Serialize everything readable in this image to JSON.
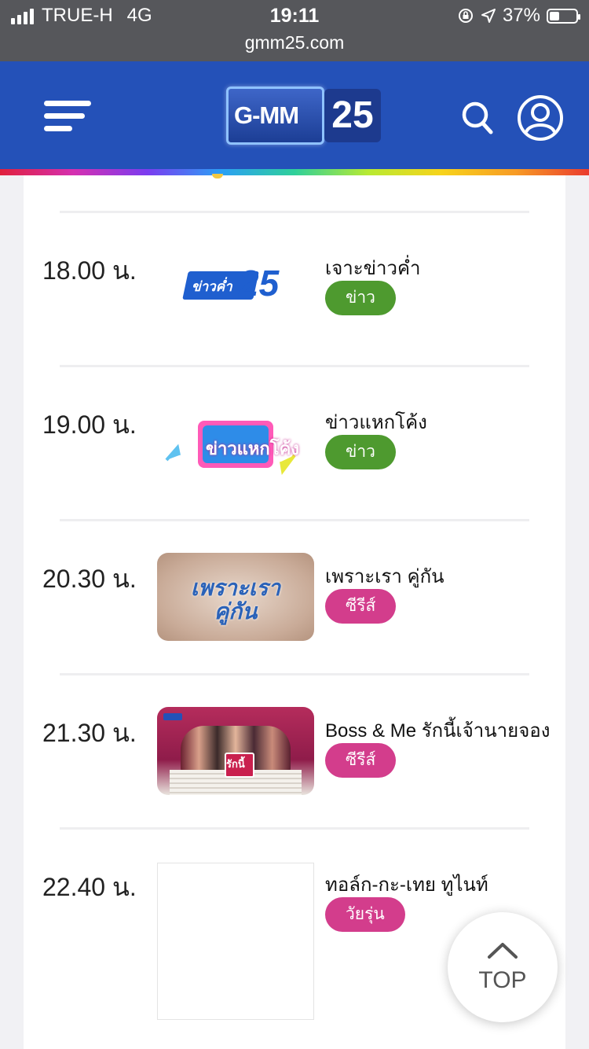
{
  "status_bar": {
    "carrier": "TRUE-H",
    "network": "4G",
    "time": "19:11",
    "url": "gmm25.com",
    "battery": "37%",
    "battery_level": 0.37
  },
  "header": {
    "logo_text": "G-MM",
    "logo_number": "25"
  },
  "schedule": [
    {
      "time": "18.00 น.",
      "title": "เจาะข่าวค่ำ",
      "genre": "ข่าว",
      "genre_color": "#4e9a2f",
      "thumb_text": "ข่าวค่ำ",
      "thumb_kind": "news25"
    },
    {
      "time": "19.00 น.",
      "title": "ข่าวแหกโค้ง",
      "genre": "ข่าว",
      "genre_color": "#4e9a2f",
      "thumb_text": "ข่าวแหกโค้ง",
      "thumb_kind": "newscurve"
    },
    {
      "time": "20.30 น.",
      "title": "เพราะเรา คู่กัน",
      "genre": "ซีรีส์",
      "genre_color": "#d33d8c",
      "thumb_text": "เพราะเรา คู่กัน",
      "thumb_kind": "series1"
    },
    {
      "time": "21.30 น.",
      "title": "Boss & Me รักนี้เจ้านายจอง",
      "genre": "ซีรีส์",
      "genre_color": "#d33d8c",
      "thumb_text": "รักนี้",
      "thumb_kind": "series2"
    },
    {
      "time": "22.40 น.",
      "title": "ทอล์ก-กะ-เทย ทูไนท์",
      "genre": "วัยรุ่น",
      "genre_color": "#d33d8c",
      "thumb_text": "",
      "thumb_kind": "blank"
    }
  ],
  "top_button": {
    "label": "TOP"
  },
  "icons": [
    "menu-icon",
    "search-icon",
    "user-icon",
    "chevron-up-icon",
    "signal-icon",
    "lock-rotation-icon",
    "location-icon",
    "battery-icon"
  ]
}
